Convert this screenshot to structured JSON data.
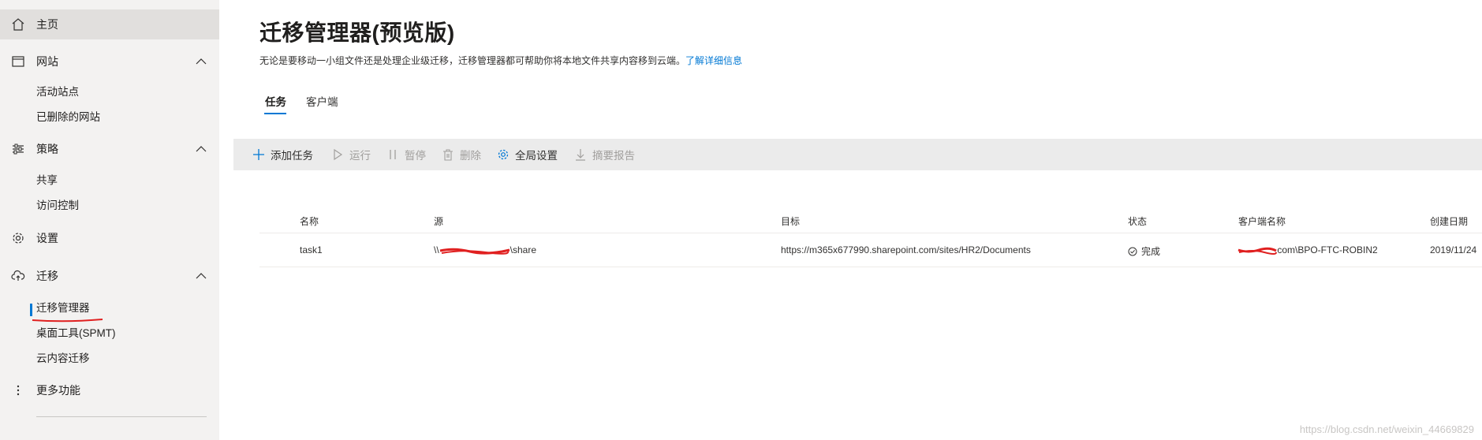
{
  "sidebar": {
    "home": {
      "label": "主页",
      "icon": "home-icon"
    },
    "sites": {
      "label": "网站",
      "icon": "browser-icon",
      "children": [
        "活动站点",
        "已删除的网站"
      ]
    },
    "policies": {
      "label": "策略",
      "icon": "sliders-icon",
      "children": [
        "共享",
        "访问控制"
      ]
    },
    "settings": {
      "label": "设置",
      "icon": "gear-icon"
    },
    "migration": {
      "label": "迁移",
      "icon": "cloud-upload-icon",
      "children": [
        "迁移管理器",
        "桌面工具(SPMT)",
        "云内容迁移"
      ]
    },
    "more": {
      "label": "更多功能",
      "icon": "more-vertical-icon"
    }
  },
  "page": {
    "title": "迁移管理器(预览版)",
    "description": "无论是要移动一小组文件还是处理企业级迁移，迁移管理器都可帮助你将本地文件共享内容移到云端。",
    "learn_more": "了解详细信息"
  },
  "tabs": [
    "任务",
    "客户端"
  ],
  "toolbar": {
    "add": "添加任务",
    "run": "运行",
    "pause": "暂停",
    "delete": "删除",
    "global_settings": "全局设置",
    "summary_report": "摘要报告"
  },
  "table": {
    "columns": [
      "名称",
      "源",
      "目标",
      "状态",
      "客户端名称",
      "创建日期"
    ],
    "rows": [
      {
        "name": "task1",
        "source_prefix": "\\\\",
        "source_suffix": "\\share",
        "target": "https://m365x677990.sharepoint.com/sites/HR2/Documents",
        "status": "完成",
        "client_suffix": ".com\\BPO-FTC-ROBIN2",
        "created": "2019/11/24"
      }
    ]
  },
  "watermark": "https://blog.csdn.net/weixin_44669829",
  "colors": {
    "accent": "#0078d4",
    "sidebar_bg": "#f3f2f1",
    "toolbar_bg": "#ebebeb",
    "redaction": "#e02020"
  }
}
